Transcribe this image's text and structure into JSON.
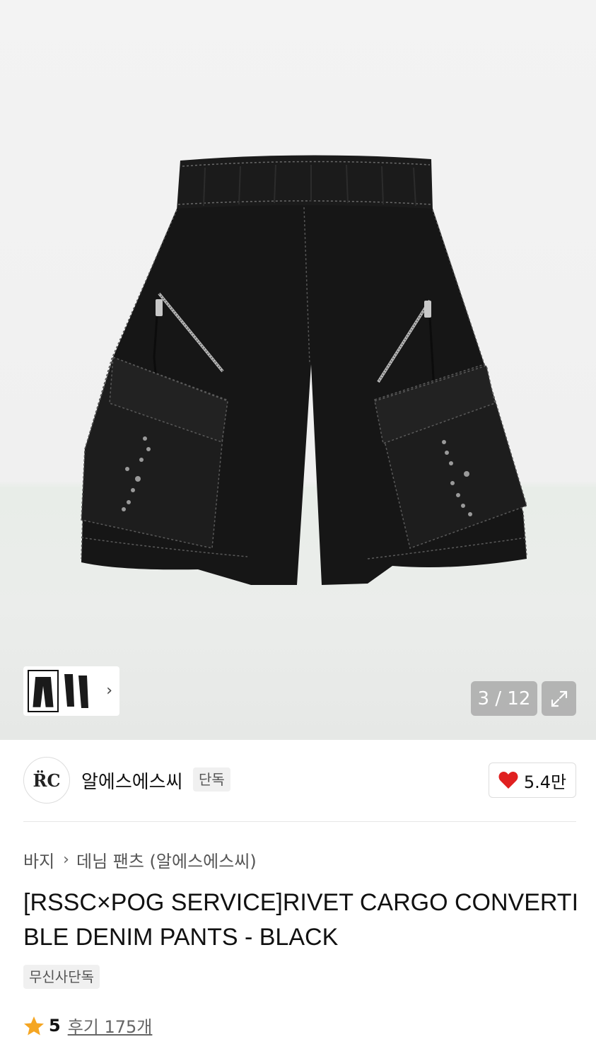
{
  "gallery": {
    "current_page": "3",
    "total_pages": "12",
    "page_label": "3 / 12",
    "thumbnail_more": "›"
  },
  "brand": {
    "logo_text": "R̈C",
    "name": "알에스에스씨",
    "badge": "단독",
    "likes": "5.4만",
    "heart_color": "#e02020"
  },
  "product": {
    "breadcrumb": [
      "바지",
      "데님 팬츠 (알에스에스씨)"
    ],
    "breadcrumb_separator": "›",
    "title": "[RSSC×POG SERVICE]RIVET CARGO CONVERTIBLE DENIM PANTS - BLACK",
    "tag": "무신사단독",
    "rating": "5",
    "reviews": "후기 175개",
    "star_color": "#f5a623"
  }
}
